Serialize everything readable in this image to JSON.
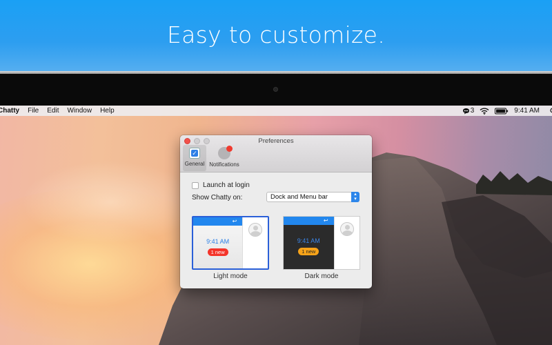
{
  "banner": {
    "title": "Easy to customize."
  },
  "menubar": {
    "app_name": "Chatty",
    "items": [
      "File",
      "Edit",
      "Window",
      "Help"
    ],
    "chat_count": "3",
    "time": "9:41 AM"
  },
  "window": {
    "title": "Preferences",
    "tabs": [
      {
        "label": "General",
        "icon": "checkmark-icon"
      },
      {
        "label": "Notifications",
        "icon": "notification-icon"
      }
    ],
    "launch_label": "Launch at login",
    "show_label": "Show Chatty on:",
    "show_value": "Dock and Menu bar",
    "modes": [
      {
        "caption": "Light mode",
        "time": "9:41 AM",
        "badge": "1 new",
        "selected": true
      },
      {
        "caption": "Dark mode",
        "time": "9:41 AM",
        "badge": "1 new",
        "selected": false
      }
    ]
  },
  "colors": {
    "banner": "#1aa0f5",
    "accent": "#2d86ea",
    "close": "#f2514b",
    "badge_light": "#f4342a",
    "badge_dark": "#f7a319"
  }
}
